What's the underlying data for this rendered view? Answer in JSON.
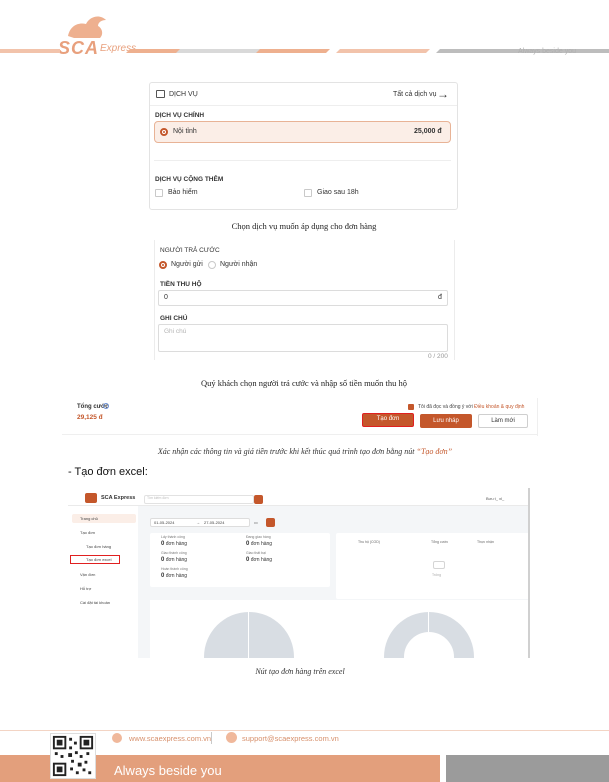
{
  "header": {
    "brand": "SCA",
    "brand_sub": "Express",
    "tagline": "Always beside you"
  },
  "service": {
    "title": "DỊCH VỤ",
    "all_link": "Tất cả dịch vụ",
    "main_label": "DỊCH VỤ CHÍNH",
    "main_option": "Nội tỉnh",
    "main_price": "25,000 đ",
    "extra_label": "DỊCH VỤ CỘNG THÊM",
    "extra_options": [
      "Bảo hiểm",
      "Giao sau 18h"
    ]
  },
  "caption1": "Chọn dịch vụ muốn áp dụng cho đơn hàng",
  "payer": {
    "label": "NGƯỜI TRẢ CƯỚC",
    "options": [
      "Người gửi",
      "Người nhận"
    ],
    "cod_label": "TIỀN THU HỘ",
    "cod_value": "0",
    "cod_unit": "đ",
    "note_label": "GHI CHÚ",
    "note_placeholder": "Ghi chú",
    "note_count": "0 / 200"
  },
  "caption2": "Quý khách chọn người trả cước và nhập số tiền muốn thu hộ",
  "confirm": {
    "total_label": "Tổng cước",
    "total_value": "29,125 đ",
    "agree_text": "Tôi đã đọc và đồng ý với",
    "agree_link": "Điều khoản & quy định",
    "create_btn": "Tạo đơn",
    "save_btn": "Lưu nháp",
    "reset_btn": "Làm mới"
  },
  "caption3": {
    "text": "Xác nhận các thông tin và giá tiền trước khi kết thúc quá trình tạo đơn bằng nút",
    "highlight": "“Tạo đơn”"
  },
  "bullet": "- Tạo đơn excel:",
  "excel_ui": {
    "brand": "SCA Express",
    "search_placeholder": "Tìm kiếm đơn",
    "user": "Bưu t_ xl_",
    "nav": [
      "Trang chủ",
      "Tạo đơn",
      "Tạo đơn hàng",
      "Tạo đơn excel",
      "Vận đơn",
      "Hỗ trợ",
      "Cài đặt tài khoản"
    ],
    "date_from": "01-05-2024",
    "date_to": "27-05-2024",
    "stats": [
      {
        "label": "Lấy thành công",
        "value": "0",
        "unit": "đơn hàng"
      },
      {
        "label": "Đang giao hàng",
        "value": "0",
        "unit": "đơn hàng"
      },
      {
        "label": "Giao thành công",
        "value": "0",
        "unit": "đơn hàng"
      },
      {
        "label": "Giao thất bại",
        "value": "0",
        "unit": "đơn hàng"
      },
      {
        "label": "Hoàn thành công",
        "value": "0",
        "unit": "đơn hàng"
      }
    ],
    "table_headers": [
      "Thu hộ (COD)",
      "Tổng cước",
      "Thực nhận"
    ],
    "empty_text": "Trống"
  },
  "caption4": "Nút tạo đơn hàng trên excel",
  "footer": {
    "website": "www.scaexpress.com.vn",
    "email": "support@scaexpress.com.vn",
    "tagline": "Always beside you"
  },
  "colors": {
    "accent": "#c4572b",
    "brand_light": "#e39f7c",
    "highlight_box": "#e02020"
  }
}
